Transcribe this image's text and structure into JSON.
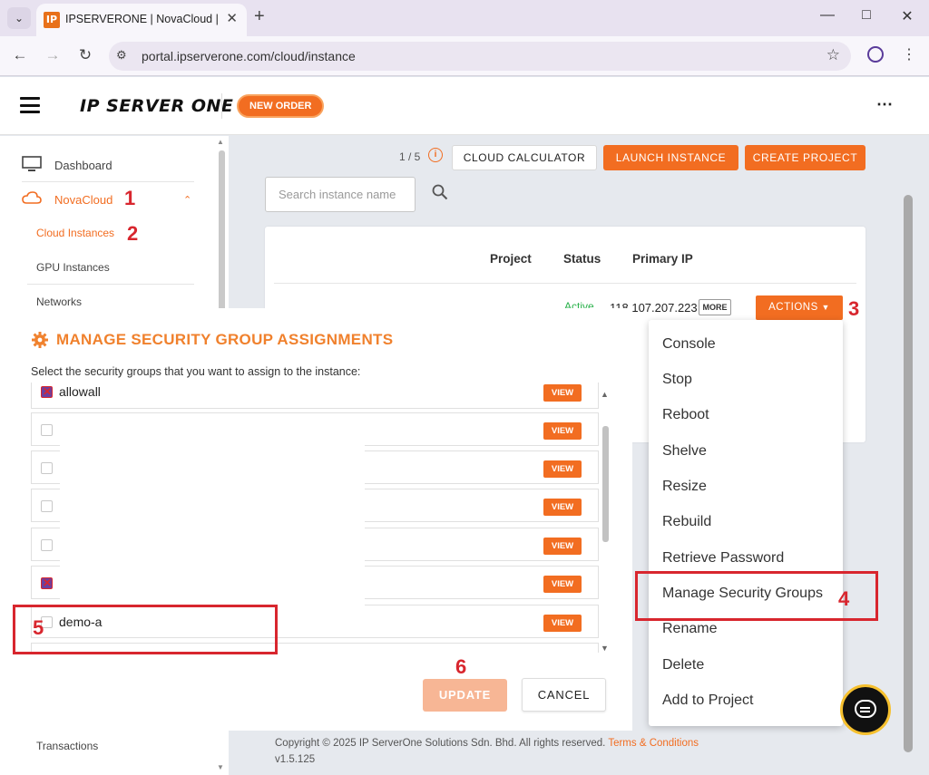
{
  "browser": {
    "tab_title": "IPSERVERONE | NovaCloud | Ins",
    "favicon_letter": "IP",
    "url": "portal.ipserverone.com/cloud/instance"
  },
  "header": {
    "logo_text": "IP SERVER ONE",
    "new_order_label": "NEW ORDER"
  },
  "sidebar": {
    "items": [
      {
        "label": "Dashboard"
      },
      {
        "label": "NovaCloud"
      },
      {
        "label": "Cloud Instances"
      },
      {
        "label": "GPU Instances"
      },
      {
        "label": "Networks"
      },
      {
        "label": "Transactions"
      }
    ]
  },
  "toolbar": {
    "quota": "1 / 5",
    "cloud_calculator_label": "CLOUD CALCULATOR",
    "launch_instance_label": "LAUNCH INSTANCE",
    "create_project_label": "CREATE PROJECT",
    "search_placeholder": "Search instance name"
  },
  "table": {
    "headers": [
      "Project",
      "Status",
      "Primary IP"
    ],
    "row": {
      "status": "Active",
      "primary_ip": "118.107.207.223",
      "more_label": "MORE",
      "actions_label": "ACTIONS"
    }
  },
  "modal": {
    "title": "MANAGE SECURITY GROUP ASSIGNMENTS",
    "subtitle": "Select the security groups that you want to assign to the instance:",
    "view_label": "VIEW",
    "groups": [
      {
        "name": "allowall",
        "checked": true
      },
      {
        "name": "",
        "checked": false
      },
      {
        "name": "",
        "checked": false
      },
      {
        "name": "",
        "checked": false
      },
      {
        "name": "",
        "checked": false
      },
      {
        "name": "",
        "checked": true
      },
      {
        "name": "demo-a",
        "checked": false
      }
    ],
    "update_label": "UPDATE",
    "cancel_label": "CANCEL"
  },
  "actions_menu": {
    "items": [
      "Console",
      "Stop",
      "Reboot",
      "Shelve",
      "Resize",
      "Rebuild",
      "Retrieve Password",
      "Manage Security Groups",
      "Rename",
      "Delete",
      "Add to Project"
    ]
  },
  "annotations": [
    "1",
    "2",
    "3",
    "4",
    "5",
    "6"
  ],
  "footer": {
    "copyright": "Copyright © 2025 IP ServerOne Solutions Sdn. Bhd. All rights reserved.",
    "terms_label": "Terms & Conditions",
    "version": "v1.5.125"
  },
  "colors": {
    "accent": "#f26d21",
    "annotation": "#d8262e",
    "active": "#2bb24c"
  }
}
